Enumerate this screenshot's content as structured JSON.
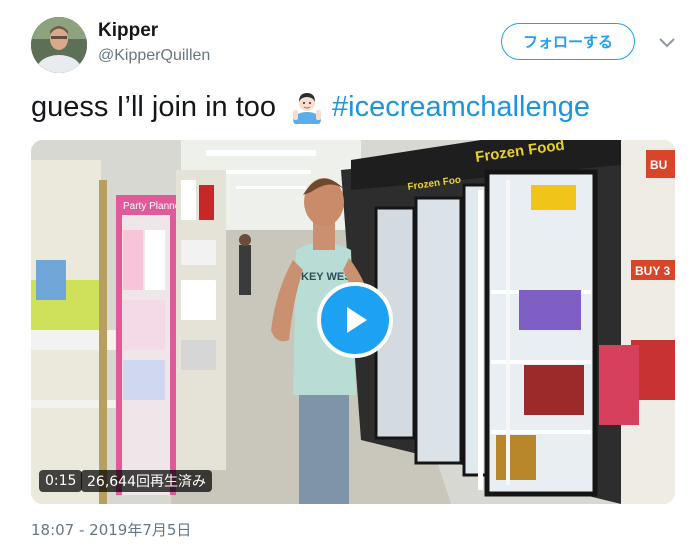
{
  "user": {
    "display_name": "Kipper",
    "handle": "@KipperQuillen"
  },
  "follow_button": {
    "label": "フォローする"
  },
  "tweet": {
    "text": "guess I’ll join in too",
    "emoji": "man-raising-hand-emoji",
    "hashtag": "#icecreamchallenge"
  },
  "video": {
    "duration": "0:15",
    "views": "26,644回再生済み",
    "scene_signs": {
      "frozen_food_top": "Frozen Food",
      "frozen_food_side": "Frozen Foo",
      "buy_small": "BU",
      "buy_three": "BUY 3",
      "party_planner": "Party Planners",
      "shirt_text": "KEY WEST"
    }
  },
  "timestamp": "18:07 - 2019年7月5日",
  "colors": {
    "accent": "#1da1f2",
    "hashtag": "#1b95e0",
    "text": "#14171a",
    "secondary": "#657786"
  }
}
